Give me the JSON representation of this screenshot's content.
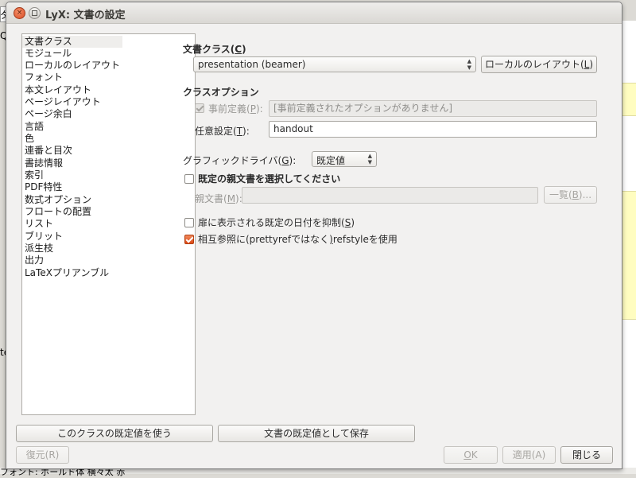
{
  "background": {
    "top_left_fragment": "タ",
    "left_text_1": "Q",
    "left_text_2": "te",
    "bottom_status": "フォント: ボールド体 横々太 赤"
  },
  "window": {
    "title": "LyX: 文書の設定",
    "close_glyph": "×"
  },
  "categories": [
    "文書クラス",
    "モジュール",
    "ローカルのレイアウト",
    "フォント",
    "本文レイアウト",
    "ページレイアウト",
    "ページ余白",
    "言語",
    "色",
    "連番と目次",
    "書誌情報",
    "索引",
    "PDF特性",
    "数式オプション",
    "フロートの配置",
    "リスト",
    "ブリット",
    "派生枝",
    "出力",
    "LaTeXプリアンブル"
  ],
  "document_class": {
    "label": "文書クラス(",
    "label_key": "C",
    "label_end": ")",
    "selected": "presentation (beamer)",
    "local_layout_button": "ローカルのレイアウト(",
    "local_layout_key": "L",
    "local_layout_end": ")"
  },
  "class_options": {
    "heading": "クラスオプション",
    "predefined_label": "事前定義(",
    "predefined_key": "P",
    "predefined_end": "):",
    "predefined_value": "[事前定義されたオプションがありません]",
    "custom_label": "任意設定(",
    "custom_key": "T",
    "custom_end": "):",
    "custom_value": "handout"
  },
  "graphics": {
    "label": "グラフィックドライバ(",
    "label_key": "G",
    "label_end": "):",
    "selected": "既定値"
  },
  "master": {
    "checkbox_label": "既定の親文書を選択してください",
    "field_label": "親文書(",
    "field_key": "M",
    "field_end": "):",
    "field_value": "",
    "browse_button": "一覧(",
    "browse_key": "B",
    "browse_end": ")..."
  },
  "options": {
    "suppress_date_label": "扉に表示される既定の日付を抑制(",
    "suppress_date_key": "S",
    "suppress_date_end": ")",
    "refstyle_label_a": "相互参照に(prettyrefではなく",
    "refstyle_key": ")",
    "refstyle_label_b": "refstyleを使用"
  },
  "bottom": {
    "use_class_defaults": "このクラスの既定値を使う",
    "save_as_default": "文書の既定値として保存",
    "restore": "復元(R)",
    "ok_key": "O",
    "ok_rest": "K",
    "apply": "適用(A)",
    "close": "閉じる"
  }
}
